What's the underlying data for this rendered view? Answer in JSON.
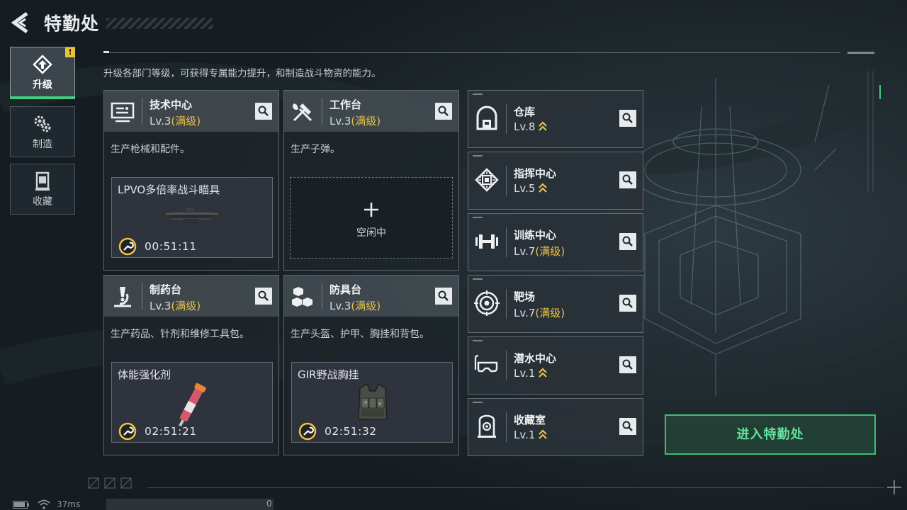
{
  "header": {
    "title": "特勤处"
  },
  "nav": {
    "tabs": [
      {
        "label": "升级",
        "icon": "upgrade-icon",
        "active": true,
        "badge": "!"
      },
      {
        "label": "制造",
        "icon": "gears-icon",
        "active": false
      },
      {
        "label": "收藏",
        "icon": "collection-icon",
        "active": false
      }
    ]
  },
  "description": "升级各部门等级，可获得专属能力提升，和制造战斗物资的能力。",
  "workshops": [
    {
      "name": "技术中心",
      "level": "Lv.3",
      "level_max": "(满级)",
      "icon": "tech-center-icon",
      "desc": "生产枪械和配件。",
      "production": {
        "item": "LPVO多倍率战斗瞄具",
        "timer": "00:51:11",
        "image": "scope-image"
      }
    },
    {
      "name": "工作台",
      "level": "Lv.3",
      "level_max": "(满级)",
      "icon": "workbench-icon",
      "desc": "生产子弹。",
      "idle": {
        "label": "空闲中"
      }
    },
    {
      "name": "制药台",
      "level": "Lv.3",
      "level_max": "(满级)",
      "icon": "microscope-icon",
      "desc": "生产药品、针剂和维修工具包。",
      "production": {
        "item": "体能强化剂",
        "timer": "02:51:21",
        "image": "injector-image"
      }
    },
    {
      "name": "防具台",
      "level": "Lv.3",
      "level_max": "(满级)",
      "icon": "armor-bench-icon",
      "desc": "生产头盔、护甲、胸挂和背包。",
      "production": {
        "item": "GIR野战胸挂",
        "timer": "02:51:32",
        "image": "chest-rig-image"
      }
    }
  ],
  "facilities": [
    {
      "name": "仓库",
      "level": "Lv.8",
      "upgradable": true,
      "icon": "warehouse-icon"
    },
    {
      "name": "指挥中心",
      "level": "Lv.5",
      "upgradable": true,
      "icon": "command-chip-icon"
    },
    {
      "name": "训练中心",
      "level": "Lv.7",
      "level_max": "(满级)",
      "icon": "dumbbell-icon"
    },
    {
      "name": "靶场",
      "level": "Lv.7",
      "level_max": "(满级)",
      "icon": "target-icon"
    },
    {
      "name": "潜水中心",
      "level": "Lv.1",
      "upgradable": true,
      "icon": "diving-mask-icon"
    },
    {
      "name": "收藏室",
      "level": "Lv.1",
      "upgradable": true,
      "icon": "collection-room-icon"
    }
  ],
  "enter_button": {
    "label": "进入特勤处"
  },
  "status": {
    "ping": "37ms",
    "input_count": "0"
  },
  "colors": {
    "accent_green": "#3bbf72",
    "max_level_gold": "#e8c14b",
    "badge_yellow": "#e9c33a"
  }
}
